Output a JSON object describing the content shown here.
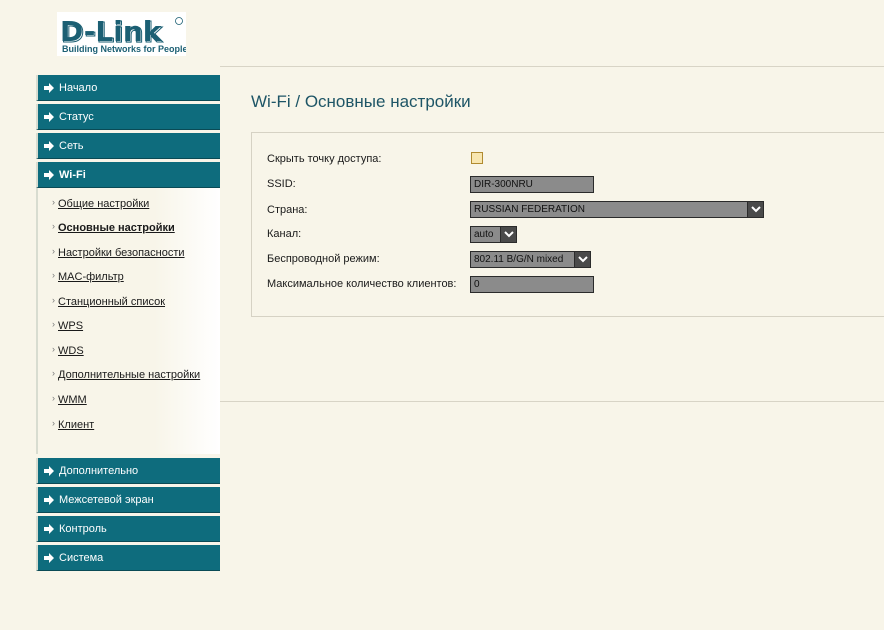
{
  "logo": {
    "brand": "D-Link",
    "tagline": "Building Networks for People"
  },
  "sidebar": {
    "items_top": [
      {
        "label": "Начало"
      },
      {
        "label": "Статус"
      },
      {
        "label": "Сеть"
      },
      {
        "label": "Wi-Fi"
      }
    ],
    "wifi_submenu": [
      {
        "label": "Общие настройки"
      },
      {
        "label": "Основные настройки"
      },
      {
        "label": "Настройки безопасности"
      },
      {
        "label": "MAC-фильтр"
      },
      {
        "label": "Станционный список"
      },
      {
        "label": "WPS"
      },
      {
        "label": "WDS"
      },
      {
        "label": "Дополнительные настройки"
      },
      {
        "label": "WMM"
      },
      {
        "label": "Клиент"
      }
    ],
    "items_bottom": [
      {
        "label": "Дополнительно"
      },
      {
        "label": "Межсетевой экран"
      },
      {
        "label": "Контроль"
      },
      {
        "label": "Система"
      }
    ]
  },
  "page": {
    "title": "Wi-Fi  / Основные настройки"
  },
  "form": {
    "hide_ap_label": "Скрыть точку доступа:",
    "hide_ap_checked": false,
    "ssid_label": "SSID:",
    "ssid_value": "DIR-300NRU",
    "country_label": "Страна:",
    "country_value": "RUSSIAN FEDERATION",
    "channel_label": "Канал:",
    "channel_value": "auto",
    "mode_label": "Беспроводной режим:",
    "mode_value": "802.11 B/G/N mixed",
    "max_clients_label": "Максимальное количество клиентов:",
    "max_clients_value": "0"
  },
  "colors": {
    "page_bg": "#f8f5e9",
    "menu_bg": "#0e6c7d",
    "title": "#1e5566",
    "input_bg": "#8b8b8b"
  },
  "icons": {
    "menu_arrow": "arrow-right-icon",
    "select_toggle": "chevron-down-icon"
  }
}
